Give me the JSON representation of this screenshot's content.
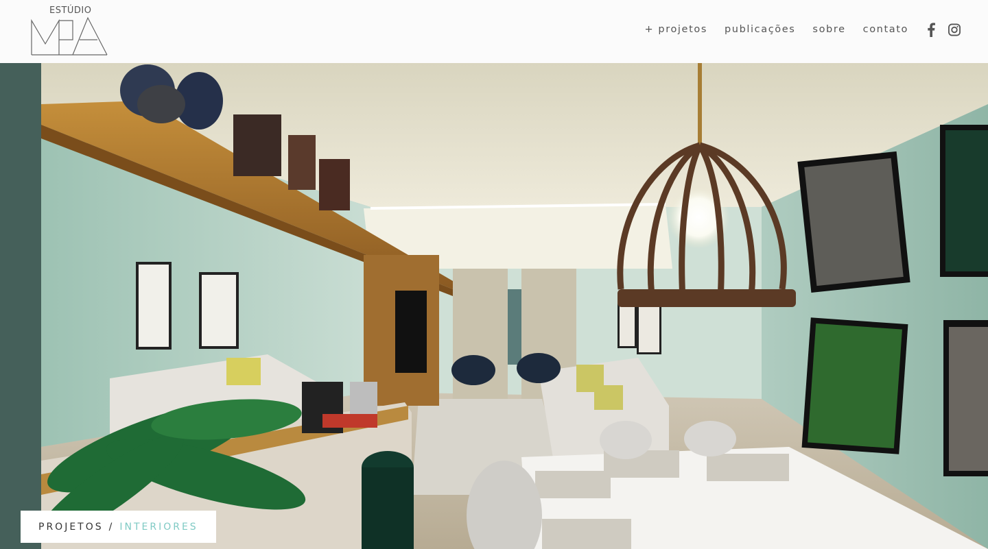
{
  "brand": {
    "top_text": "ESTÚDIO",
    "mark": "MPA"
  },
  "nav": {
    "items": [
      {
        "label": "+ projetos"
      },
      {
        "label": "publicações"
      },
      {
        "label": "sobre"
      },
      {
        "label": "contato"
      }
    ],
    "social": [
      {
        "icon": "facebook-icon"
      },
      {
        "icon": "instagram-icon"
      }
    ]
  },
  "hero": {
    "description_icon": "interior-render-image"
  },
  "breadcrumb": {
    "parent": "PROJETOS",
    "separator": "/",
    "current": "INTERIORES"
  },
  "colors": {
    "accent": "#7fcac4",
    "text": "#555555",
    "background": "#fbfbfb"
  }
}
